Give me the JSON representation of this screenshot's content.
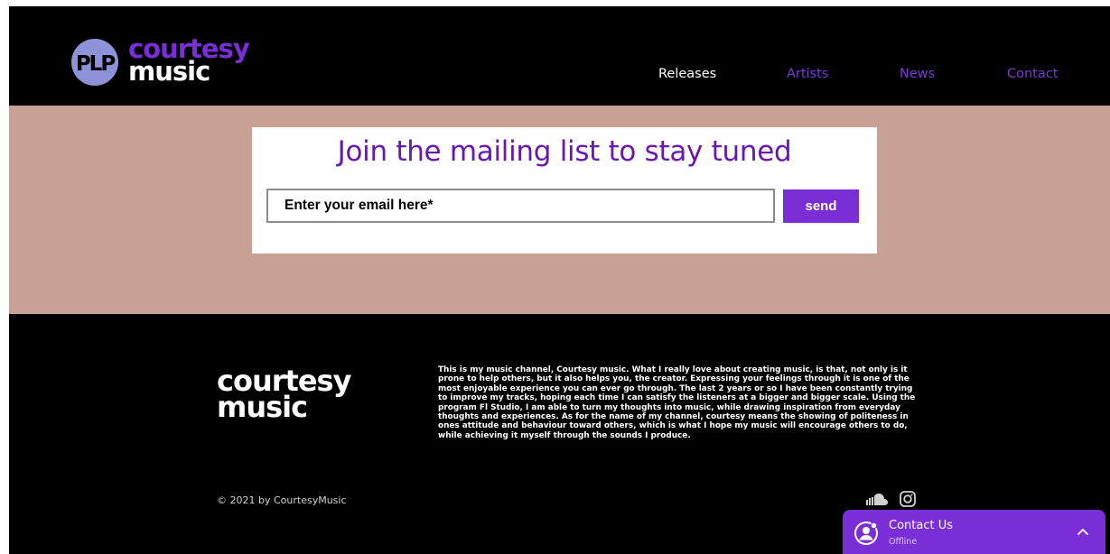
{
  "brand": {
    "badge_text": "PLP",
    "name_line1": "courtesy",
    "name_line2": "music",
    "color_purple": "#6a16b3",
    "color_badge": "#8d92d9"
  },
  "nav": {
    "items": [
      {
        "label": "Releases",
        "active": true
      },
      {
        "label": "Artists",
        "active": false
      },
      {
        "label": "News",
        "active": false
      },
      {
        "label": "Contact",
        "active": false
      }
    ]
  },
  "mailing": {
    "title": "Join the mailing list to stay tuned",
    "email_placeholder": "Enter your email here*",
    "email_value": "",
    "send_label": "send",
    "band_color": "#c9a094",
    "accent": "#7a2ed6"
  },
  "footer": {
    "logo_line1": "courtesy",
    "logo_line2": "music",
    "about": "This is my music channel, Courtesy music. What I really love about creating music, is that, not only is it prone to help others, but it also helps you, the creator. Expressing your feelings through it is one of the most enjoyable experience you can ever go through.  The last 2 years or so I have been constantly trying to improve my tracks, hoping each time I can satisfy the listeners at a bigger and bigger scale. Using the program Fl Studio, I am able to turn my thoughts into music, while drawing inspiration from everyday thoughts and experiences. As for the name of my channel, courtesy means the showing of politeness in ones attitude and behaviour toward others, which is what I hope my music will encourage others to do, while achieving it myself through the sounds I produce.",
    "copyright": "© 2021 by CourtesyMusic",
    "social_icons": [
      "soundcloud-icon",
      "instagram-icon"
    ]
  },
  "chat": {
    "title": "Contact Us",
    "status": "Offline",
    "icon": "chat-avatar-icon"
  }
}
